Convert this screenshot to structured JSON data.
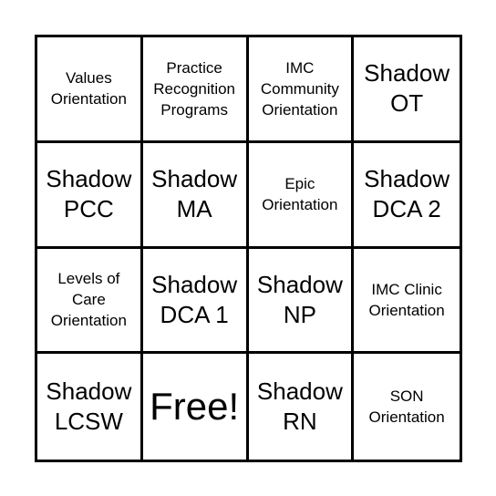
{
  "card": {
    "cells": [
      {
        "label": "Values\nOrientation",
        "size": "small"
      },
      {
        "label": "Practice\nRecognition\nPrograms",
        "size": "small"
      },
      {
        "label": "IMC\nCommunity\nOrientation",
        "size": "small"
      },
      {
        "label": "Shadow\nOT",
        "size": "large"
      },
      {
        "label": "Shadow\nPCC",
        "size": "large"
      },
      {
        "label": "Shadow\nMA",
        "size": "large"
      },
      {
        "label": "Epic\nOrientation",
        "size": "small"
      },
      {
        "label": "Shadow\nDCA 2",
        "size": "large"
      },
      {
        "label": "Levels of\nCare\nOrientation",
        "size": "small"
      },
      {
        "label": "Shadow\nDCA 1",
        "size": "large"
      },
      {
        "label": "Shadow\nNP",
        "size": "large"
      },
      {
        "label": "IMC Clinic\nOrientation",
        "size": "small"
      },
      {
        "label": "Shadow\nLCSW",
        "size": "large"
      },
      {
        "label": "Free!",
        "size": "free"
      },
      {
        "label": "Shadow\nRN",
        "size": "large"
      },
      {
        "label": "SON\nOrientation",
        "size": "small"
      }
    ]
  }
}
